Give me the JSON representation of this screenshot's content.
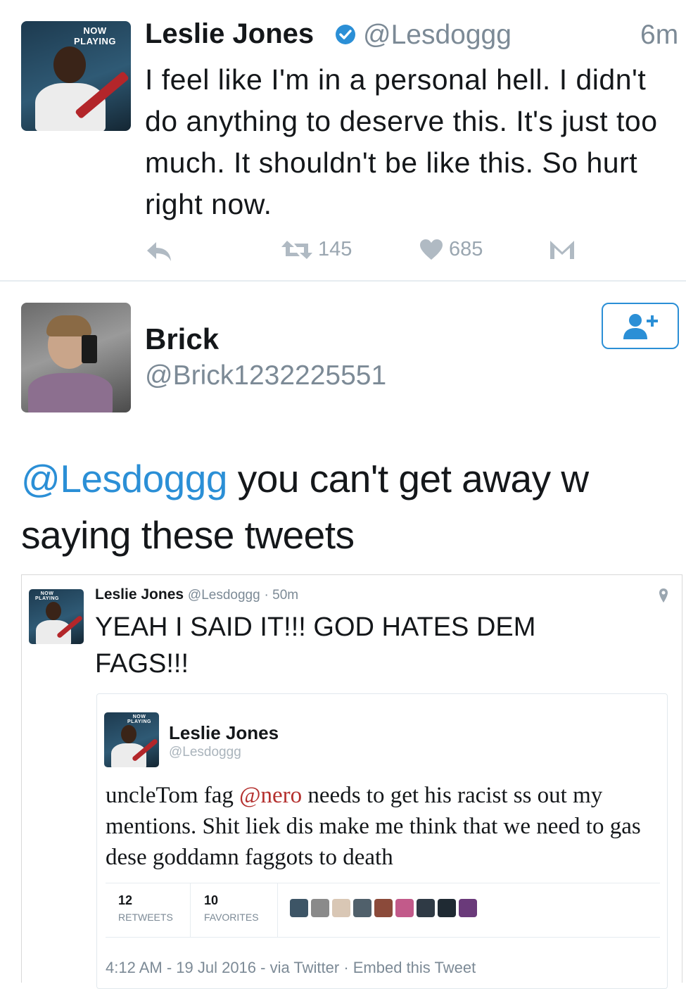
{
  "tweet1": {
    "badge": "NOW PLAYING",
    "name": "Leslie Jones",
    "handle": "@Lesdoggg",
    "time": "6m",
    "text": "I feel like I'm in a personal hell. I didn't do anything to deserve this. It's just too much. It shouldn't be like this. So hurt right now.",
    "retweets": "145",
    "likes": "685"
  },
  "tweet2": {
    "name": "Brick",
    "handle": "@Brick1232225551",
    "mention": "@Lesdoggg",
    "text": " you can't get away w saying these tweets"
  },
  "quoted": {
    "badge": "NOW PLAYING",
    "name": "Leslie Jones",
    "handle": "@Lesdoggg",
    "time": "· 50m",
    "text": "YEAH I SAID IT!!! GOD HATES DEM FAGS!!!"
  },
  "embedded": {
    "badge": "NOW PLAYING",
    "name": "Leslie Jones",
    "handle": "@Lesdoggg",
    "text_pre": "uncleTom fag ",
    "mention": "@nero",
    "text_post": " needs to get his racist ss out my mentions. Shit liek dis make me think that we need to gas dese goddamn faggots to death",
    "retweets_count": "12",
    "retweets_label": "RETWEETS",
    "favorites_count": "10",
    "favorites_label": "FAVORITES",
    "footer": "4:12 AM - 19 Jul 2016 - via Twitter · Embed this Tweet",
    "thumb_colors": [
      "#3d5566",
      "#8a8a8a",
      "#d9c7b5",
      "#50606b",
      "#8b4a3a",
      "#c25a8a",
      "#2f3a45",
      "#1f2a33",
      "#6a3a7a"
    ]
  },
  "colors": {
    "link": "#2b8fd6",
    "muted": "#7c8a96",
    "like_icon": "#b0bac3"
  },
  "icons": [
    "reply-icon",
    "retweet-icon",
    "heart-icon",
    "message-icon",
    "follow-icon",
    "location-icon"
  ]
}
